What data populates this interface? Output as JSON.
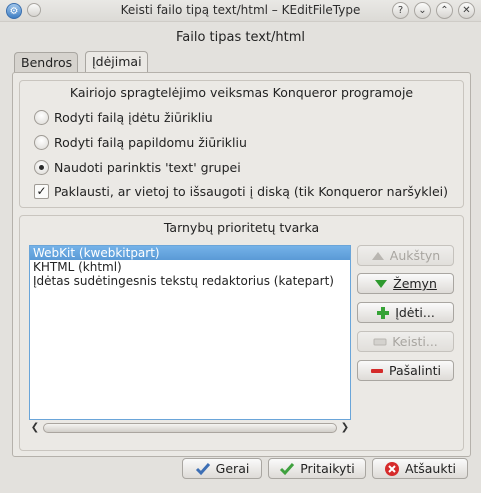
{
  "window": {
    "title": "Keisti failo tipą text/html – KEditFileType"
  },
  "heading": "Failo tipas text/html",
  "tabs": [
    {
      "label": "Bendros"
    },
    {
      "label": "Įdėjimai"
    }
  ],
  "click_action": {
    "title": "Kairiojo spragtelėjimo veiksmas Konqueror programoje",
    "options": [
      {
        "label": "Rodyti failą įdėtu žiūrikliu",
        "selected": false
      },
      {
        "label": "Rodyti failą papildomu žiūrikliu",
        "selected": false
      },
      {
        "label": "Naudoti parinktis 'text' grupei",
        "selected": true
      }
    ],
    "ask_label": "Paklausti, ar vietoj to išsaugoti į diską (tik Konqueror naršyklei)",
    "ask_checked": true
  },
  "services": {
    "title": "Tarnybų prioritetų tvarka",
    "items": [
      {
        "label": "WebKit (kwebkitpart)",
        "selected": true
      },
      {
        "label": "KHTML (khtml)",
        "selected": false
      },
      {
        "label": "Įdėtas sudėtingesnis tekstų redaktorius (katepart)",
        "selected": false
      }
    ],
    "buttons": {
      "up": "Aukštyn",
      "down": "Žemyn",
      "add": "Įdėti...",
      "edit": "Keisti...",
      "remove": "Pašalinti"
    }
  },
  "footer": {
    "ok": "Gerai",
    "apply": "Pritaikyti",
    "cancel": "Atšaukti"
  },
  "colors": {
    "accent": "#5a9ad6",
    "window_bg": "#e3e1dd"
  }
}
